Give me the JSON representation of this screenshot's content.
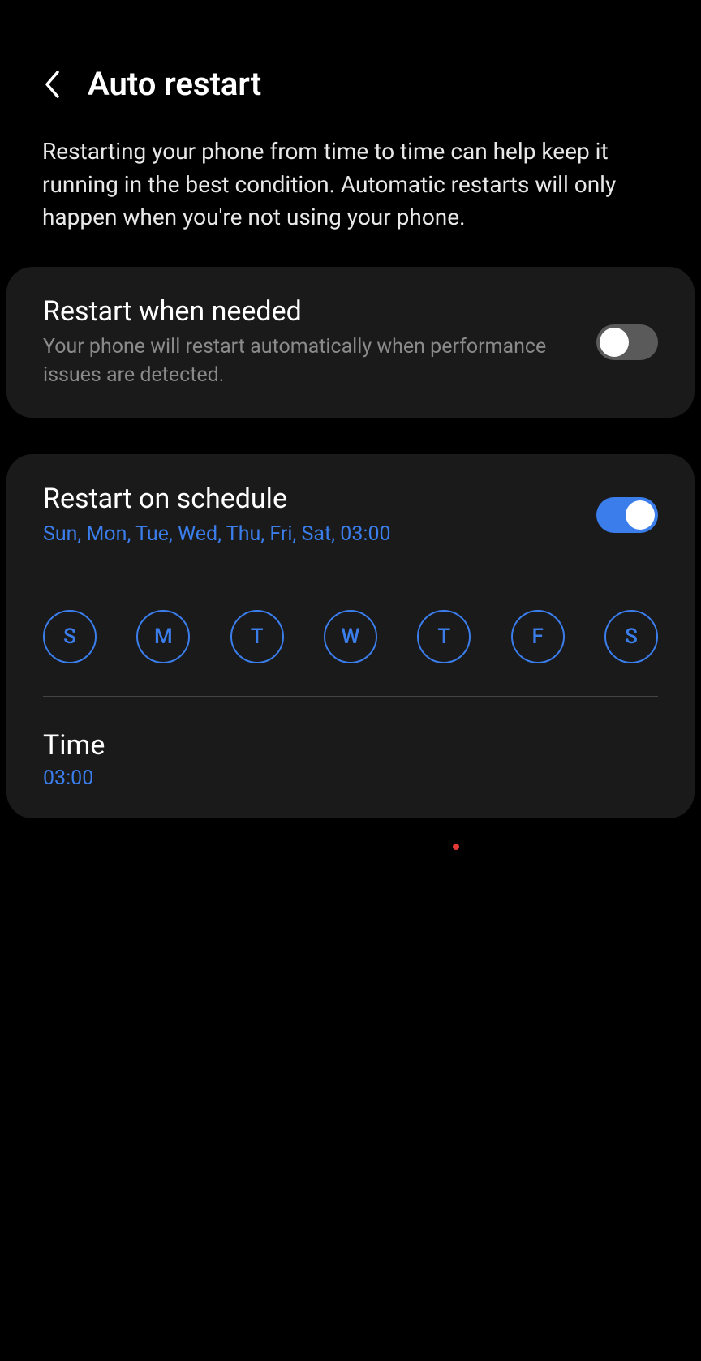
{
  "header": {
    "title": "Auto restart"
  },
  "description": "Restarting your phone from time to time can help keep it running in the best condition. Automatic restarts will only happen when you're not using your phone.",
  "restartWhenNeeded": {
    "title": "Restart when needed",
    "subtitle": "Your phone will restart automatically when performance issues are detected.",
    "enabled": false
  },
  "restartOnSchedule": {
    "title": "Restart on schedule",
    "subtitle": "Sun, Mon, Tue, Wed, Thu, Fri, Sat, 03:00",
    "enabled": true,
    "days": [
      "S",
      "M",
      "T",
      "W",
      "T",
      "F",
      "S"
    ],
    "timeLabel": "Time",
    "timeValue": "03:00"
  }
}
